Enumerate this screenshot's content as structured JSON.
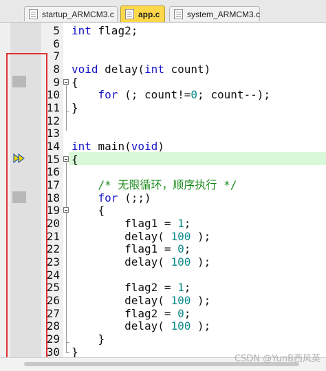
{
  "tabs": [
    {
      "label": "startup_ARMCM3.c",
      "active": false
    },
    {
      "label": "app.c",
      "active": true
    },
    {
      "label": "system_ARMCM3.c",
      "active": false
    }
  ],
  "lines": [
    {
      "n": "5",
      "html": "<span class=\"kw\">int</span> flag2;"
    },
    {
      "n": "6",
      "html": ""
    },
    {
      "n": "7",
      "html": ""
    },
    {
      "n": "8",
      "html": "<span class=\"kw\">void</span> delay(<span class=\"kw\">int</span> count)"
    },
    {
      "n": "9",
      "html": "{"
    },
    {
      "n": "10",
      "html": "    <span class=\"kw\">for</span> (; count!=<span class=\"num\">0</span>; count--);"
    },
    {
      "n": "11",
      "html": "}"
    },
    {
      "n": "12",
      "html": ""
    },
    {
      "n": "13",
      "html": ""
    },
    {
      "n": "14",
      "html": "<span class=\"kw\">int</span> main(<span class=\"kw\">void</span>)"
    },
    {
      "n": "15",
      "html": "{"
    },
    {
      "n": "16",
      "html": ""
    },
    {
      "n": "17",
      "html": "    <span class=\"cmt\">/* 无限循环，顺序执行 */</span>"
    },
    {
      "n": "18",
      "html": "    <span class=\"kw\">for</span> (;;)"
    },
    {
      "n": "19",
      "html": "    {"
    },
    {
      "n": "20",
      "html": "        flag1 = <span class=\"num\">1</span>;"
    },
    {
      "n": "21",
      "html": "        delay( <span class=\"num\">100</span> );"
    },
    {
      "n": "22",
      "html": "        flag1 = <span class=\"num\">0</span>;"
    },
    {
      "n": "23",
      "html": "        delay( <span class=\"num\">100</span> );"
    },
    {
      "n": "24",
      "html": ""
    },
    {
      "n": "25",
      "html": "        flag2 = <span class=\"num\">1</span>;"
    },
    {
      "n": "26",
      "html": "        delay( <span class=\"num\">100</span> );"
    },
    {
      "n": "27",
      "html": "        flag2 = <span class=\"num\">0</span>;"
    },
    {
      "n": "28",
      "html": "        delay( <span class=\"num\">100</span> );"
    },
    {
      "n": "29",
      "html": "    }"
    },
    {
      "n": "30",
      "html": "}"
    }
  ],
  "current_line": "15",
  "colors": {
    "keyword": "#1515c8",
    "number": "#0b8a8a",
    "comment": "#1c8a1c",
    "active_tab": "#ffd84a",
    "current_line_bg": "#d8f8d8",
    "annotation_box": "#e03030"
  },
  "icons": {
    "tab": "file-icon",
    "execution_marker": "debug-arrow-icon"
  },
  "watermark": "CSDN @YunB西风英"
}
